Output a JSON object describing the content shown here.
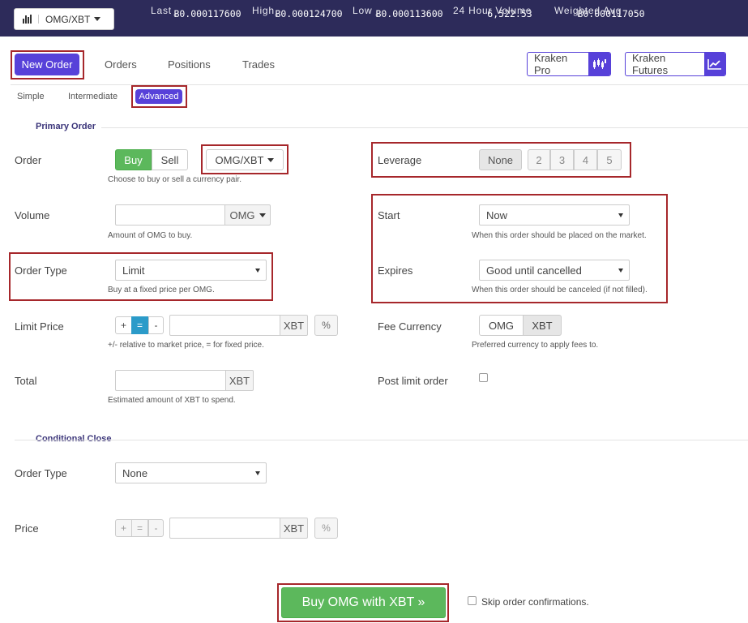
{
  "header": {
    "pair_selector": "OMG/XBT",
    "stats": [
      {
        "label": "Last",
        "value": "Ƀ0.000117600"
      },
      {
        "label": "High",
        "value": "Ƀ0.000124700"
      },
      {
        "label": "Low",
        "value": "Ƀ0.000113600"
      },
      {
        "label": "24 Hour Volume",
        "value": "6,522.53"
      },
      {
        "label": "Weighted Avg",
        "value": "Ƀ0.000117050"
      }
    ]
  },
  "nav": {
    "tabs": [
      "New Order",
      "Orders",
      "Positions",
      "Trades"
    ],
    "active_tab": "New Order",
    "external": [
      "Kraken Pro",
      "Kraken Futures"
    ]
  },
  "order_modes": {
    "simple": "Simple",
    "intermediate": "Intermediate",
    "advanced": "Advanced",
    "active": "Advanced"
  },
  "primary": {
    "title": "Primary Order",
    "order": {
      "label": "Order",
      "buy": "Buy",
      "sell": "Sell",
      "selected": "Buy",
      "pair": "OMG/XBT",
      "help": "Choose to buy or sell a currency pair."
    },
    "volume": {
      "label": "Volume",
      "value": "",
      "unit": "OMG",
      "help": "Amount of OMG to buy."
    },
    "order_type": {
      "label": "Order Type",
      "value": "Limit",
      "help": "Buy at a fixed price per OMG."
    },
    "limit_price": {
      "label": "Limit Price",
      "plus": "+",
      "eq": "=",
      "minus": "-",
      "value": "",
      "unit": "XBT",
      "pct": "%",
      "help": "+/- relative to market price, = for fixed price."
    },
    "total": {
      "label": "Total",
      "value": "",
      "unit": "XBT",
      "help": "Estimated amount of XBT to spend."
    },
    "leverage": {
      "label": "Leverage",
      "options": [
        "None",
        "2",
        "3",
        "4",
        "5"
      ],
      "selected": "None"
    },
    "start": {
      "label": "Start",
      "value": "Now",
      "help": "When this order should be placed on the market."
    },
    "expires": {
      "label": "Expires",
      "value": "Good until cancelled",
      "help": "When this order should be canceled (if not filled)."
    },
    "fee_currency": {
      "label": "Fee Currency",
      "options": [
        "OMG",
        "XBT"
      ],
      "selected": "XBT",
      "help": "Preferred currency to apply fees to."
    },
    "post_limit": {
      "label": "Post limit order",
      "checked": false
    }
  },
  "conditional": {
    "title": "Conditional Close",
    "order_type": {
      "label": "Order Type",
      "value": "None"
    },
    "price": {
      "label": "Price",
      "plus": "+",
      "eq": "=",
      "minus": "-",
      "value": "",
      "unit": "XBT",
      "pct": "%"
    }
  },
  "submit": {
    "label": "Buy OMG with XBT »",
    "skip_label": "Skip order confirmations.",
    "skip_checked": false
  },
  "colors": {
    "topbar": "#2d2b5a",
    "accent": "#5741d9",
    "buy_green": "#5cb85c",
    "highlight_red": "#a6272b"
  }
}
